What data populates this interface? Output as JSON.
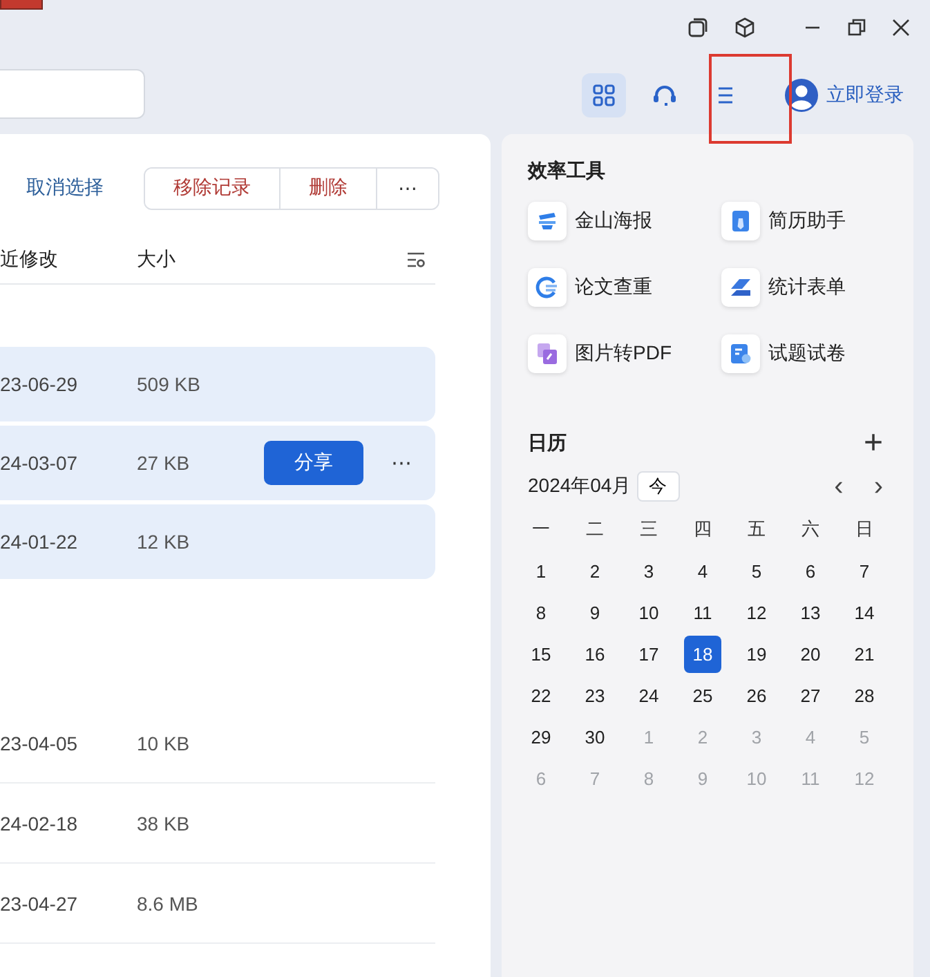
{
  "toolbar": {
    "tools": [
      {
        "kind": "grid",
        "selected": true
      },
      {
        "kind": "headset",
        "selected": false
      },
      {
        "kind": "menu",
        "selected": false
      }
    ],
    "login": "立即登录"
  },
  "file_list": {
    "cancel_selection": "取消选择",
    "actions": [
      "移除记录",
      "删除"
    ],
    "more": "⋯",
    "columns": [
      "近修改",
      "大小"
    ],
    "rows": [
      {
        "modified": "23-06-29",
        "size": "509 KB",
        "selected": true
      },
      {
        "modified": "24-03-07",
        "size": "27 KB",
        "selected": true,
        "share": "分享",
        "more": "⋯"
      },
      {
        "modified": "24-01-22",
        "size": "12 KB",
        "selected": true
      },
      {
        "modified": "23-04-05",
        "size": "10 KB",
        "selected": false
      },
      {
        "modified": "24-02-18",
        "size": "38 KB",
        "selected": false
      },
      {
        "modified": "23-04-27",
        "size": "8.6 MB",
        "selected": false
      }
    ]
  },
  "tools": {
    "title": "效率工具",
    "items": [
      {
        "label": "金山海报",
        "kind": "poster"
      },
      {
        "label": "简历助手",
        "kind": "resume"
      },
      {
        "label": "论文查重",
        "kind": "thesis"
      },
      {
        "label": "统计表单",
        "kind": "form"
      },
      {
        "label": "图片转PDF",
        "kind": "pdf"
      },
      {
        "label": "试题试卷",
        "kind": "exam"
      }
    ]
  },
  "calendar": {
    "title": "日历",
    "add": "+",
    "month": "2024年04月",
    "today": "今",
    "prev": "‹",
    "next": "›",
    "weekdays": [
      "一",
      "二",
      "三",
      "四",
      "五",
      "六",
      "日"
    ],
    "days": [
      {
        "day": "1",
        "in_month": true,
        "selected": false
      },
      {
        "day": "2",
        "in_month": true,
        "selected": false
      },
      {
        "day": "3",
        "in_month": true,
        "selected": false
      },
      {
        "day": "4",
        "in_month": true,
        "selected": false
      },
      {
        "day": "5",
        "in_month": true,
        "selected": false
      },
      {
        "day": "6",
        "in_month": true,
        "selected": false
      },
      {
        "day": "7",
        "in_month": true,
        "selected": false
      },
      {
        "day": "8",
        "in_month": true,
        "selected": false
      },
      {
        "day": "9",
        "in_month": true,
        "selected": false
      },
      {
        "day": "10",
        "in_month": true,
        "selected": false
      },
      {
        "day": "11",
        "in_month": true,
        "selected": false
      },
      {
        "day": "12",
        "in_month": true,
        "selected": false
      },
      {
        "day": "13",
        "in_month": true,
        "selected": false
      },
      {
        "day": "14",
        "in_month": true,
        "selected": false
      },
      {
        "day": "15",
        "in_month": true,
        "selected": false
      },
      {
        "day": "16",
        "in_month": true,
        "selected": false
      },
      {
        "day": "17",
        "in_month": true,
        "selected": false
      },
      {
        "day": "18",
        "in_month": true,
        "selected": true
      },
      {
        "day": "19",
        "in_month": true,
        "selected": false
      },
      {
        "day": "20",
        "in_month": true,
        "selected": false
      },
      {
        "day": "21",
        "in_month": true,
        "selected": false
      },
      {
        "day": "22",
        "in_month": true,
        "selected": false
      },
      {
        "day": "23",
        "in_month": true,
        "selected": false
      },
      {
        "day": "24",
        "in_month": true,
        "selected": false
      },
      {
        "day": "25",
        "in_month": true,
        "selected": false
      },
      {
        "day": "26",
        "in_month": true,
        "selected": false
      },
      {
        "day": "27",
        "in_month": true,
        "selected": false
      },
      {
        "day": "28",
        "in_month": true,
        "selected": false
      },
      {
        "day": "29",
        "in_month": true,
        "selected": false
      },
      {
        "day": "30",
        "in_month": true,
        "selected": false
      },
      {
        "day": "1",
        "in_month": false,
        "selected": false
      },
      {
        "day": "2",
        "in_month": false,
        "selected": false
      },
      {
        "day": "3",
        "in_month": false,
        "selected": false
      },
      {
        "day": "4",
        "in_month": false,
        "selected": false
      },
      {
        "day": "5",
        "in_month": false,
        "selected": false
      },
      {
        "day": "6",
        "in_month": false,
        "selected": false
      },
      {
        "day": "7",
        "in_month": false,
        "selected": false
      },
      {
        "day": "8",
        "in_month": false,
        "selected": false
      },
      {
        "day": "9",
        "in_month": false,
        "selected": false
      },
      {
        "day": "10",
        "in_month": false,
        "selected": false
      },
      {
        "day": "11",
        "in_month": false,
        "selected": false
      },
      {
        "day": "12",
        "in_month": false,
        "selected": false
      }
    ]
  }
}
